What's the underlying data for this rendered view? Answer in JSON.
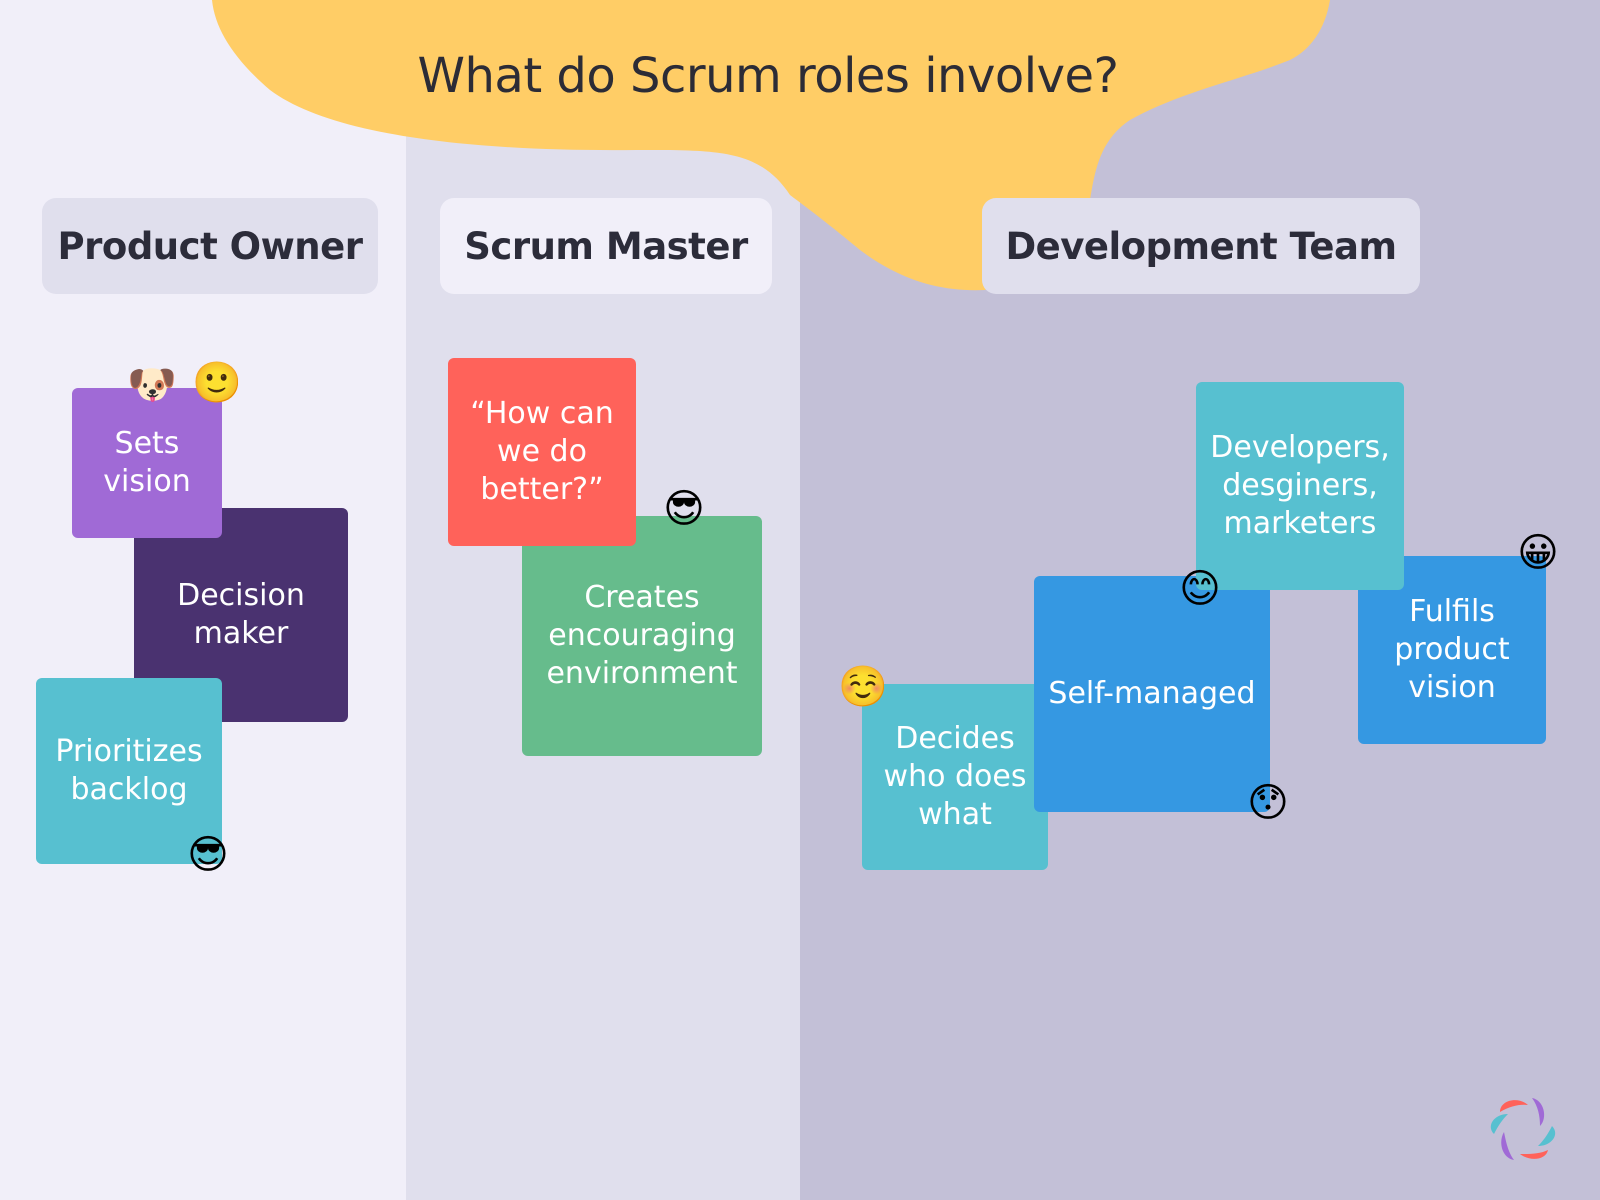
{
  "title": "What do Scrum roles involve?",
  "colors": {
    "blob": "#ffcd66",
    "purple": "#a06ad6",
    "dark_purple": "#4a3270",
    "teal": "#57c0d0",
    "red": "#ff625a",
    "green": "#66bc8c",
    "blue": "#3598e2"
  },
  "columns": [
    {
      "header": "Product Owner",
      "cards": [
        {
          "text": "Sets\nvision",
          "color": "purple"
        },
        {
          "text": "Decision\nmaker",
          "color": "dark_purple"
        },
        {
          "text": "Prioritizes\nbacklog",
          "color": "teal"
        }
      ],
      "emojis": [
        "🐶",
        "🙂",
        "😎"
      ]
    },
    {
      "header": "Scrum Master",
      "cards": [
        {
          "text": "“How can\nwe do\nbetter?”",
          "color": "red"
        },
        {
          "text": "Creates\nencouraging\nenvironment",
          "color": "green"
        }
      ],
      "emojis": [
        "😎"
      ]
    },
    {
      "header": "Development Team",
      "cards": [
        {
          "text": "Developers,\ndesginers,\nmarketers",
          "color": "teal"
        },
        {
          "text": "Fulfils\nproduct\nvision",
          "color": "blue"
        },
        {
          "text": "Self-managed",
          "color": "blue"
        },
        {
          "text": "Decides\nwho does\nwhat",
          "color": "teal"
        }
      ],
      "emojis": [
        "😊",
        "😀",
        "☺️",
        "😯"
      ]
    }
  ]
}
